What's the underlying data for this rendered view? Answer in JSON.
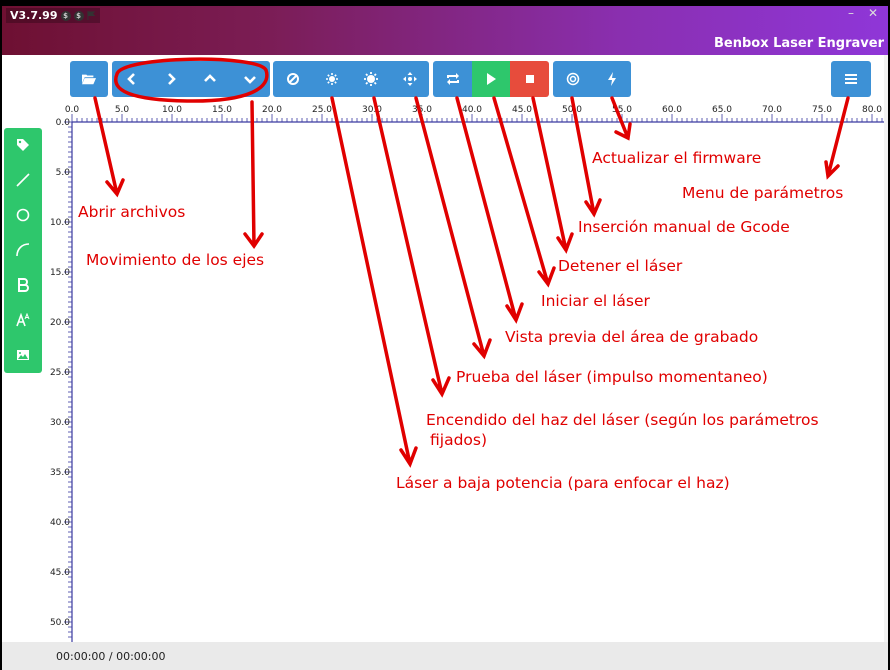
{
  "app": {
    "version": "V3.7.99",
    "title": "Benbox Laser Engraver",
    "minimize": "–",
    "close": "✕"
  },
  "toolbar": {
    "open": {
      "icon": "folder-open-icon"
    },
    "axes": [
      {
        "icon": "chevron-left-icon"
      },
      {
        "icon": "chevron-right-icon"
      },
      {
        "icon": "chevron-up-icon"
      },
      {
        "icon": "chevron-down-icon"
      }
    ],
    "laser": [
      {
        "icon": "ban-icon"
      },
      {
        "icon": "small-sun-icon"
      },
      {
        "icon": "sun-icon"
      },
      {
        "icon": "crosshair-move-icon"
      }
    ],
    "run": [
      {
        "icon": "repeat-icon"
      },
      {
        "icon": "play-icon"
      },
      {
        "icon": "stop-icon"
      }
    ],
    "misc": [
      {
        "icon": "target-icon"
      },
      {
        "icon": "bolt-icon"
      }
    ],
    "menu": {
      "icon": "hamburger-menu-icon"
    },
    "colors": {
      "blue": "#3d91d6",
      "green": "#2ec76c",
      "red": "#e74c3c"
    }
  },
  "sidebar": [
    {
      "icon": "tag-icon"
    },
    {
      "icon": "line-icon"
    },
    {
      "icon": "circle-icon"
    },
    {
      "icon": "arc-icon"
    },
    {
      "icon": "bold-text-icon"
    },
    {
      "icon": "font-size-icon"
    },
    {
      "icon": "image-icon"
    }
  ],
  "rulers": {
    "h_labels": [
      "0.0",
      "5.0",
      "10.0",
      "15.0",
      "20.0",
      "25.0",
      "30.0",
      "35.0",
      "40.0",
      "45.0",
      "50.0",
      "55.0",
      "60.0",
      "65.0",
      "70.0",
      "75.0",
      "80.0"
    ],
    "v_labels": [
      "0.0",
      "5.0",
      "10.0",
      "15.0",
      "20.0",
      "25.0",
      "30.0",
      "35.0",
      "40.0",
      "45.0",
      "50.0"
    ]
  },
  "status": {
    "time": "00:00:00 / 00:00:00"
  },
  "annotations": [
    {
      "key": "open",
      "text": "Abrir archivos"
    },
    {
      "key": "axes",
      "text": "Movimiento de los ejes"
    },
    {
      "key": "low",
      "text": "Láser a baja potencia (para enfocar el haz)"
    },
    {
      "key": "beam",
      "text": "Encendido del haz del láser (según los parámetros"
    },
    {
      "key": "beam2",
      "text": "fijados)"
    },
    {
      "key": "test",
      "text": "Prueba del láser (impulso momentaneo)"
    },
    {
      "key": "preview",
      "text": "Vista previa del área de grabado"
    },
    {
      "key": "start",
      "text": "Iniciar el láser"
    },
    {
      "key": "stop",
      "text": "Detener el láser"
    },
    {
      "key": "gcode",
      "text": "Inserción manual de Gcode"
    },
    {
      "key": "firmware",
      "text": "Actualizar el firmware"
    },
    {
      "key": "menu",
      "text": "Menu de parámetros"
    }
  ],
  "annotation_color": "#e00000"
}
